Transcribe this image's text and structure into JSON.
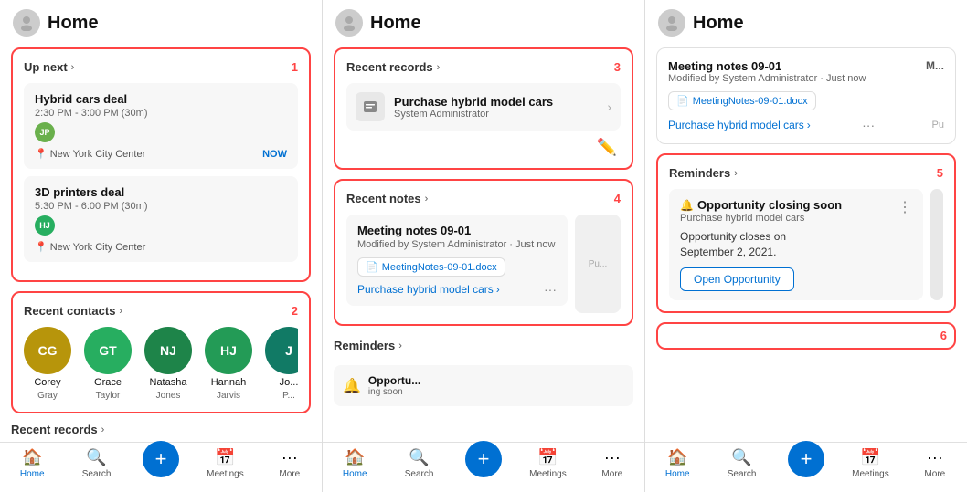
{
  "panels": [
    {
      "id": "panel1",
      "header": {
        "title": "Home",
        "avatar": "👤"
      },
      "sections": [
        {
          "id": "up-next",
          "label": "Up next",
          "badge": "1",
          "items": [
            {
              "title": "Hybrid cars deal",
              "time": "2:30 PM - 3:00 PM (30m)",
              "initials": "JP",
              "color": "#6ab04c",
              "location": "New York City Center",
              "badge": "NOW"
            },
            {
              "title": "3D printers deal",
              "time": "5:30 PM - 6:00 PM (30m)",
              "initials": "HJ",
              "color": "#27ae60",
              "location": "New York City Center",
              "badge": ""
            }
          ]
        },
        {
          "id": "recent-contacts",
          "label": "Recent contacts",
          "badge": "2",
          "contacts": [
            {
              "initials": "CG",
              "name": "Corey",
              "last": "Gray",
              "color": "#b7950b"
            },
            {
              "initials": "GT",
              "name": "Grace",
              "last": "Taylor",
              "color": "#27ae60"
            },
            {
              "initials": "NJ",
              "name": "Natasha",
              "last": "Jones",
              "color": "#1e8449"
            },
            {
              "initials": "HJ",
              "name": "Hannah",
              "last": "Jarvis",
              "color": "#239b56"
            },
            {
              "initials": "J",
              "name": "Jo...",
              "last": "P...",
              "color": "#117a65"
            }
          ]
        },
        {
          "id": "recent-records",
          "label": "Recent records",
          "badge": ""
        }
      ],
      "nav": [
        {
          "icon": "🏠",
          "label": "Home",
          "active": true
        },
        {
          "icon": "🔍",
          "label": "Search",
          "active": false
        },
        {
          "icon": "➕",
          "label": "",
          "fab": true
        },
        {
          "icon": "📅",
          "label": "Meetings",
          "active": false
        },
        {
          "icon": "···",
          "label": "More",
          "active": false
        }
      ]
    },
    {
      "id": "panel2",
      "header": {
        "title": "Home",
        "avatar": "👤"
      },
      "sections": [
        {
          "id": "recent-records",
          "label": "Recent records",
          "badge": "3",
          "record": {
            "icon": "💼",
            "title": "Purchase hybrid model cars",
            "sub": "System Administrator"
          }
        },
        {
          "id": "recent-notes",
          "label": "Recent notes",
          "badge": "4",
          "note": {
            "title": "Meeting notes 09-01",
            "sub": "Modified by System Administrator · Just now",
            "file": "MeetingNotes-09-01.docx",
            "link": "Purchase hybrid model cars"
          }
        },
        {
          "id": "reminders",
          "label": "Reminders",
          "badge": ""
        }
      ],
      "nav": [
        {
          "icon": "🏠",
          "label": "Home",
          "active": true
        },
        {
          "icon": "🔍",
          "label": "Search",
          "active": false
        },
        {
          "icon": "➕",
          "label": "",
          "fab": true
        },
        {
          "icon": "📅",
          "label": "Meetings",
          "active": false
        },
        {
          "icon": "···",
          "label": "More",
          "active": false
        }
      ]
    },
    {
      "id": "panel3",
      "header": {
        "title": "Home",
        "avatar": "👤"
      },
      "sections": [
        {
          "id": "meeting-notes",
          "label": "Meeting notes 09-01",
          "sub": "Modified by System Administrator · Just now",
          "badge": "M..."
        },
        {
          "id": "reminders",
          "label": "Reminders",
          "badge": "5",
          "reminder": {
            "title": "Opportunity closing soon",
            "sub": "Purchase hybrid model cars",
            "body": "Opportunity closes on\nSeptember 2, 2021.",
            "btn": "Open Opportunity"
          }
        }
      ],
      "badge6": "6",
      "nav": [
        {
          "icon": "🏠",
          "label": "Home",
          "active": true
        },
        {
          "icon": "🔍",
          "label": "Search",
          "active": false
        },
        {
          "icon": "➕",
          "label": "",
          "fab": true
        },
        {
          "icon": "📅",
          "label": "Meetings",
          "active": false
        },
        {
          "icon": "···",
          "label": "More",
          "active": false
        }
      ]
    }
  ]
}
